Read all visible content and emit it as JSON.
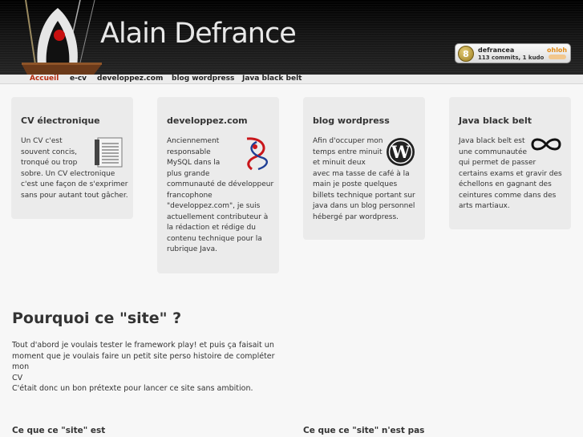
{
  "header": {
    "title": "Alain Defrance",
    "ohloh": {
      "rank": "8",
      "user": "defrancea",
      "stats": "113 commits, 1 kudo",
      "brand": "ohloh"
    }
  },
  "nav": {
    "items": [
      {
        "label": "Accueil",
        "active": true
      },
      {
        "label": "e-cv"
      },
      {
        "label": "developpez.com"
      },
      {
        "label": "blog wordpress"
      },
      {
        "label": "Java black belt"
      }
    ]
  },
  "cards": [
    {
      "title": "CV électronique",
      "text": "Un CV c'est\nsouvent concis,\ntronqué ou trop\nsobre. Un CV electronique\nc'est une façon de s'exprimer\nsans pour autant tout gâcher.",
      "icon": "document-list-icon"
    },
    {
      "title": "developpez.com",
      "text": "Anciennement\nresponsable\nMySQL dans la\nplus grande\ncommunauté de développeur\nfrancophone\n\"developpez.com\", je suis\nactuellement contributeur à\nla rédaction et rédige du\ncontenu technique pour la\nrubrique Java.",
      "icon": "developpez-logo-icon"
    },
    {
      "title": "blog wordpress",
      "text": "Afin d'occuper mon\ntemps entre minuit\net minuit deux\navec ma tasse de café à la\nmain je poste quelques\nbillets technique portant sur\njava dans un blog personnel\nhébergé par wordpress.",
      "icon": "wordpress-icon"
    },
    {
      "title": "Java black belt",
      "text": "Java black belt est\nune communautée\nqui permet de passer\ncertains exams et gravir des\néchellons en gagnant des\nceintures comme dans des\narts martiaux.",
      "icon": "infinity-icon"
    }
  ],
  "section": {
    "title": "Pourquoi ce \"site\" ?",
    "text": "Tout d'abord je voulais tester le framework play! et puis ça faisait un\nmoment que je voulais faire un petit site perso histoire de compléter mon\nCV\nC'était donc un bon prétexte pour lancer ce site sans ambition.",
    "col_left_title": "Ce que ce \"site\" est",
    "col_right_title": "Ce que ce \"site\" n'est pas"
  },
  "colors": {
    "accent": "#b82c0f",
    "card_bg": "#ebebeb",
    "header_bg": "#141414"
  }
}
